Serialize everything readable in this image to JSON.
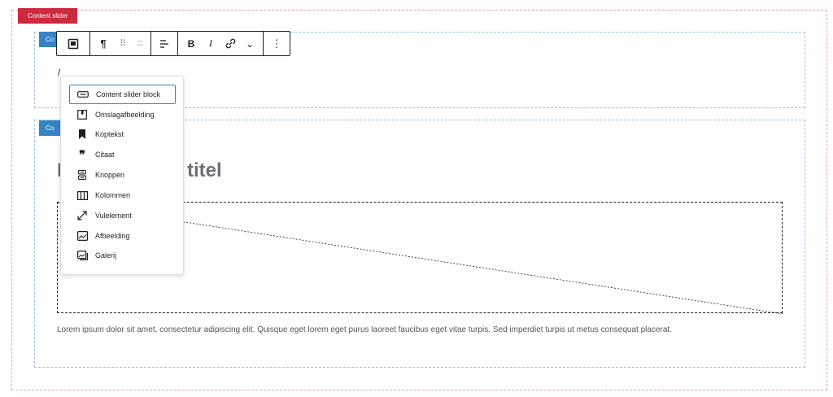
{
  "outer_block": {
    "label": "Content slider"
  },
  "inner_blocks": [
    {
      "tag": "Co"
    },
    {
      "tag": "Co"
    }
  ],
  "first_block": {
    "text": "/"
  },
  "second_block": {
    "heading_start": "I",
    "heading_end": "titel",
    "paragraph": "Lorem ipsum dolor sit amet, consectetur adipiscing elit. Quisque eget lorem eget purus laoreet faucibus eget vitae turpis. Sed imperdiet turpis ut metus consequat placerat."
  },
  "toolbar": {
    "paragraph_symbol": "¶",
    "drag_symbol": "⠿",
    "bold": "B",
    "italic": "I",
    "more_symbol": "⋮",
    "chevron_symbol": "⌄"
  },
  "dropdown": {
    "items": [
      {
        "label": "Content slider block",
        "icon": "slider-icon"
      },
      {
        "label": "Omslagafbeelding",
        "icon": "cover-icon"
      },
      {
        "label": "Koptekst",
        "icon": "bookmark-icon"
      },
      {
        "label": "Citaat",
        "icon": "quote-icon"
      },
      {
        "label": "Knoppen",
        "icon": "buttons-icon"
      },
      {
        "label": "Kolommen",
        "icon": "columns-icon"
      },
      {
        "label": "Vulelement",
        "icon": "expand-icon"
      },
      {
        "label": "Afbeelding",
        "icon": "image-icon"
      },
      {
        "label": "Galerij",
        "icon": "gallery-icon"
      }
    ]
  },
  "colors": {
    "outer_label_bg": "#cc2a3f",
    "inner_tag_bg": "#3582c4",
    "selected_border": "#3582c4"
  }
}
